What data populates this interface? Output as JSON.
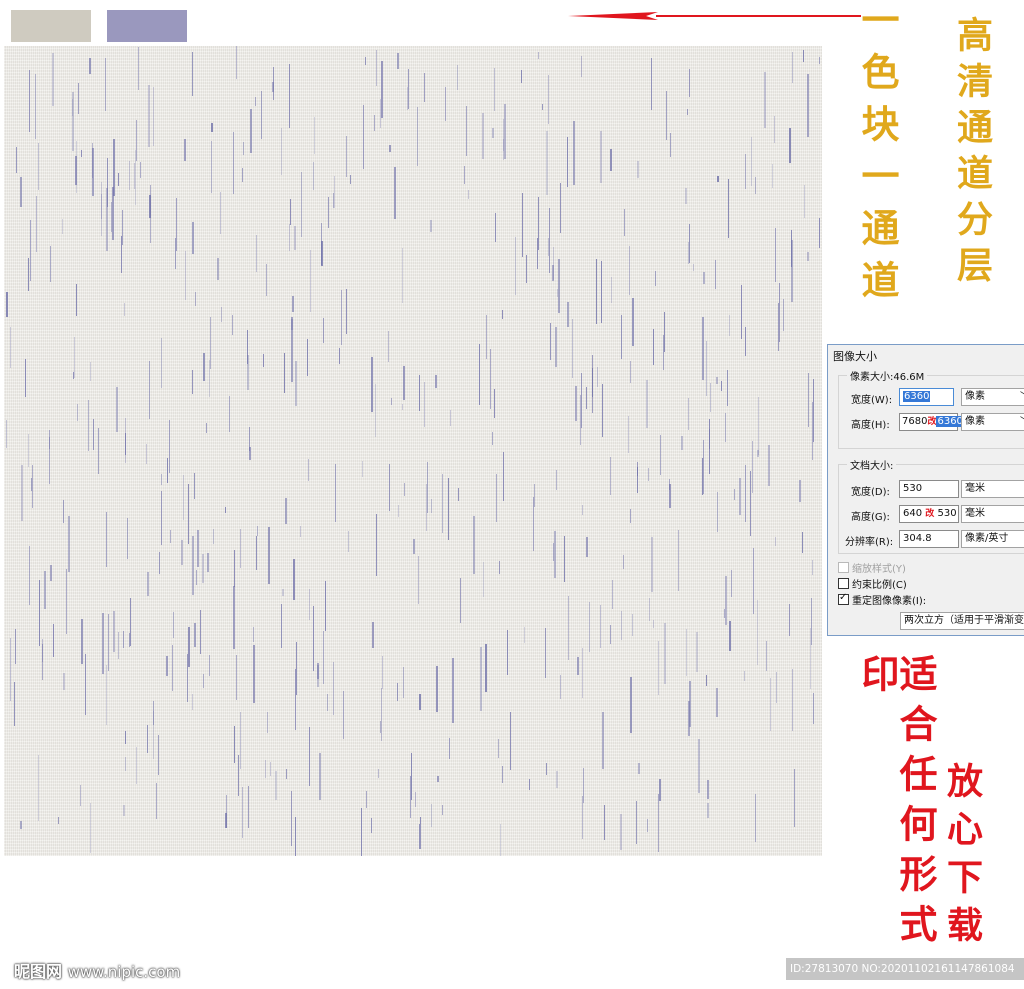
{
  "swatches": [
    {
      "name": "beige",
      "color": "#cfcbc0"
    },
    {
      "name": "violet",
      "color": "#9a98be"
    }
  ],
  "captions": {
    "left_gold": "一色块一通道",
    "right_gold": "高清通道分层",
    "left_red": "适合任何形式印",
    "right_red": "放心下载"
  },
  "dialog": {
    "title": "图像大小",
    "pixel_group": {
      "label": "像素大小:46.6M",
      "width_label": "宽度(W):",
      "width_value": "6360",
      "width_unit": "像素",
      "height_label": "高度(H):",
      "height_value_old": "7680",
      "height_value_new": "6360",
      "height_unit": "像素"
    },
    "doc_group": {
      "label": "文档大小:",
      "width_label": "宽度(D):",
      "width_value": "530",
      "width_unit": "毫米",
      "height_label": "高度(G):",
      "height_value_old": "640",
      "height_value_new": "530",
      "height_unit": "毫米",
      "res_label": "分辨率(R):",
      "res_value": "304.8",
      "res_unit": "像素/英寸"
    },
    "link_mark": "改",
    "scale_styles": "缩放样式(Y)",
    "constrain": "约束比例(C)",
    "resample": "重定图像像素(I):",
    "resample_method": "两次立方（适用于平滑渐变"
  },
  "watermark": {
    "brand": "昵图网",
    "domain": "www.nipic.com",
    "id_text": "ID:27813070 NO:20201102161147861084"
  },
  "colors": {
    "gold": "#e0a81c",
    "red": "#e0161e",
    "arrow": "#e0161e",
    "texture_base": "#eceae4",
    "streak": "#6d6ea8"
  },
  "icons": {
    "arrow": "left-arrow-icon",
    "chevron": "chevron-down-icon",
    "checkbox": "checkbox-icon"
  }
}
